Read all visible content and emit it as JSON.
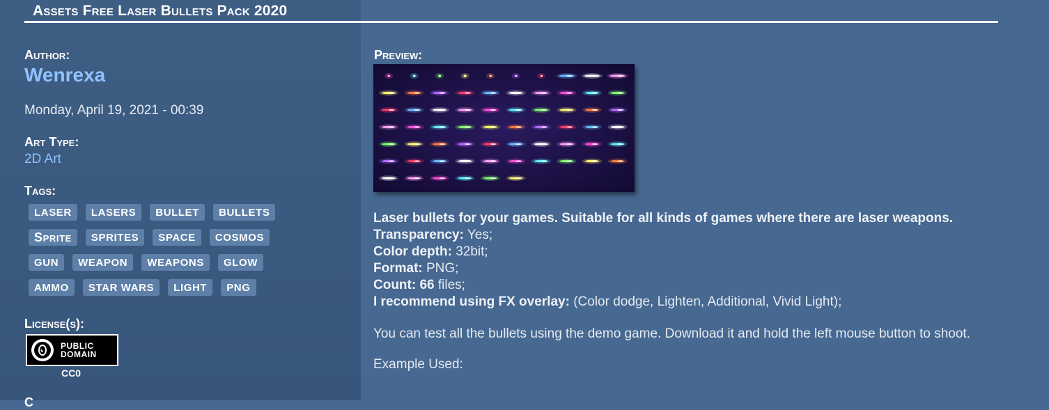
{
  "page": {
    "title": "Assets Free Laser Bullets Pack 2020"
  },
  "meta": {
    "author_label": "Author:",
    "author_name": "Wenrexa",
    "date": "Monday, April 19, 2021 - 00:39",
    "art_type_label": "Art Type:",
    "art_type": "2D Art",
    "tags_label": "Tags:",
    "tags": [
      [
        "LASER",
        "LASERS",
        "BULLET",
        "BULLETS"
      ],
      [
        "Sprite",
        "SPRITES",
        "SPACE",
        "COSMOS"
      ],
      [
        "GUN",
        "WEAPON",
        "WEAPONS",
        "GLOW"
      ],
      [
        "AMMO",
        "STAR WARS",
        "LIGHT",
        "PNG"
      ]
    ],
    "license_label": "License(s):",
    "license_badge_line1": "PUBLIC",
    "license_badge_line2": "DOMAIN",
    "license_name": "CC0",
    "cut_label": "C"
  },
  "main": {
    "preview_label": "Preview:",
    "preview_image_alt": "laser bullets sprite sheet preview",
    "intro": "Laser bullets for your games. Suitable for all kinds of games where there are laser weapons.",
    "specs": [
      {
        "label": "Transparency:",
        "value": " Yes;"
      },
      {
        "label": "Color depth:",
        "value": " 32bit;"
      },
      {
        "label": "Format:",
        "value": " PNG;"
      },
      {
        "label": "Count: 66",
        "value": " files;"
      },
      {
        "label": "I recommend using FX overlay:",
        "value": " (Color dodge, Lighten, Additional, Vivid Light);"
      }
    ],
    "demo_text": "You can test all the bullets using the demo game. Download it and hold the left mouse button to shoot.",
    "example_label": "Example Used:"
  },
  "colors": {
    "background": "#476891",
    "left_column": "#3c5b80",
    "link": "#8fc2ff",
    "tag_bg": "#5d7fa8",
    "preview_bg": "#1a0f42"
  }
}
